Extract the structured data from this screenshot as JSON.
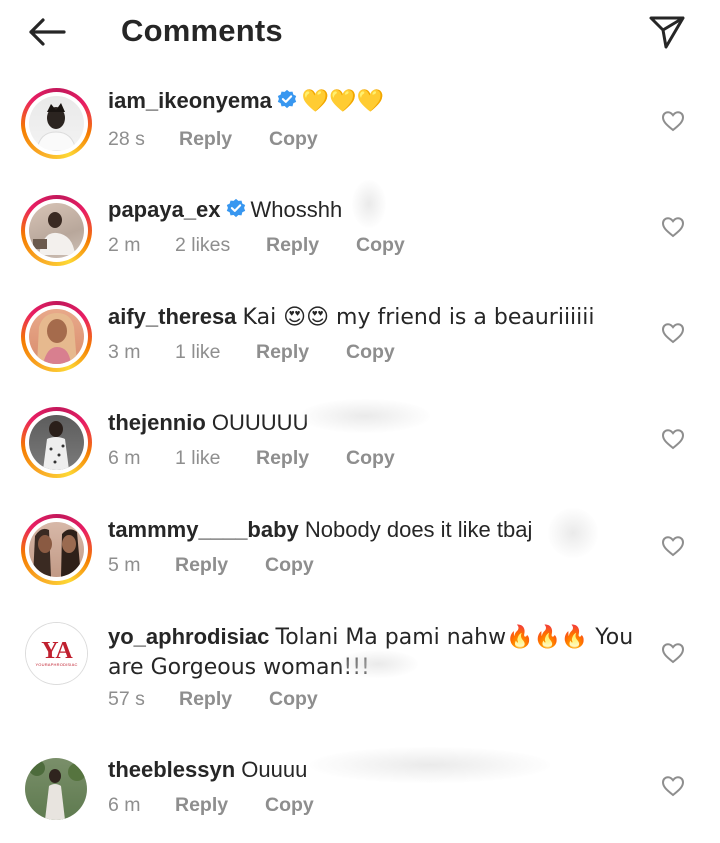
{
  "header": {
    "title": "Comments",
    "back_icon": "arrow-left-icon",
    "share_icon": "paper-plane-icon"
  },
  "colors": {
    "verified": "#3897f0",
    "meta_text": "#8e8e8e",
    "story_ring_start": "#f9a825",
    "story_ring_end": "#e91e63"
  },
  "comments": [
    {
      "username": "iam_ikeonyema",
      "verified": true,
      "text": "💛💛💛",
      "time": "28 s",
      "likes": "",
      "reply": "Reply",
      "copy": "Copy"
    },
    {
      "username": "papaya_ex",
      "verified": true,
      "text": "Whosshh",
      "time": "2 m",
      "likes": "2 likes",
      "reply": "Reply",
      "copy": "Copy"
    },
    {
      "username": "aify_theresa",
      "verified": false,
      "text": "Kai 😍😍 my friend is a beauriiiiii",
      "time": "3 m",
      "likes": "1 like",
      "reply": "Reply",
      "copy": "Copy"
    },
    {
      "username": "thejennio",
      "verified": false,
      "text": "OUUUUU",
      "time": "6 m",
      "likes": "1 like",
      "reply": "Reply",
      "copy": "Copy"
    },
    {
      "username": "tammmy____baby",
      "verified": false,
      "text": "Nobody does it like tbaj",
      "time": "5 m",
      "likes": "",
      "reply": "Reply",
      "copy": "Copy"
    },
    {
      "username": "yo_aphrodisiac",
      "verified": false,
      "text": "Tolani Ma pami nahw🔥🔥🔥 You are Gorgeous woman!!!",
      "time": "57 s",
      "likes": "",
      "reply": "Reply",
      "copy": "Copy",
      "avatar_logo": "YA",
      "avatar_subtext": "YOURAPHRODISIAC"
    },
    {
      "username": "theeblessyn",
      "verified": false,
      "text": "Ouuuu",
      "time": "6 m",
      "likes": "",
      "reply": "Reply",
      "copy": "Copy"
    }
  ]
}
